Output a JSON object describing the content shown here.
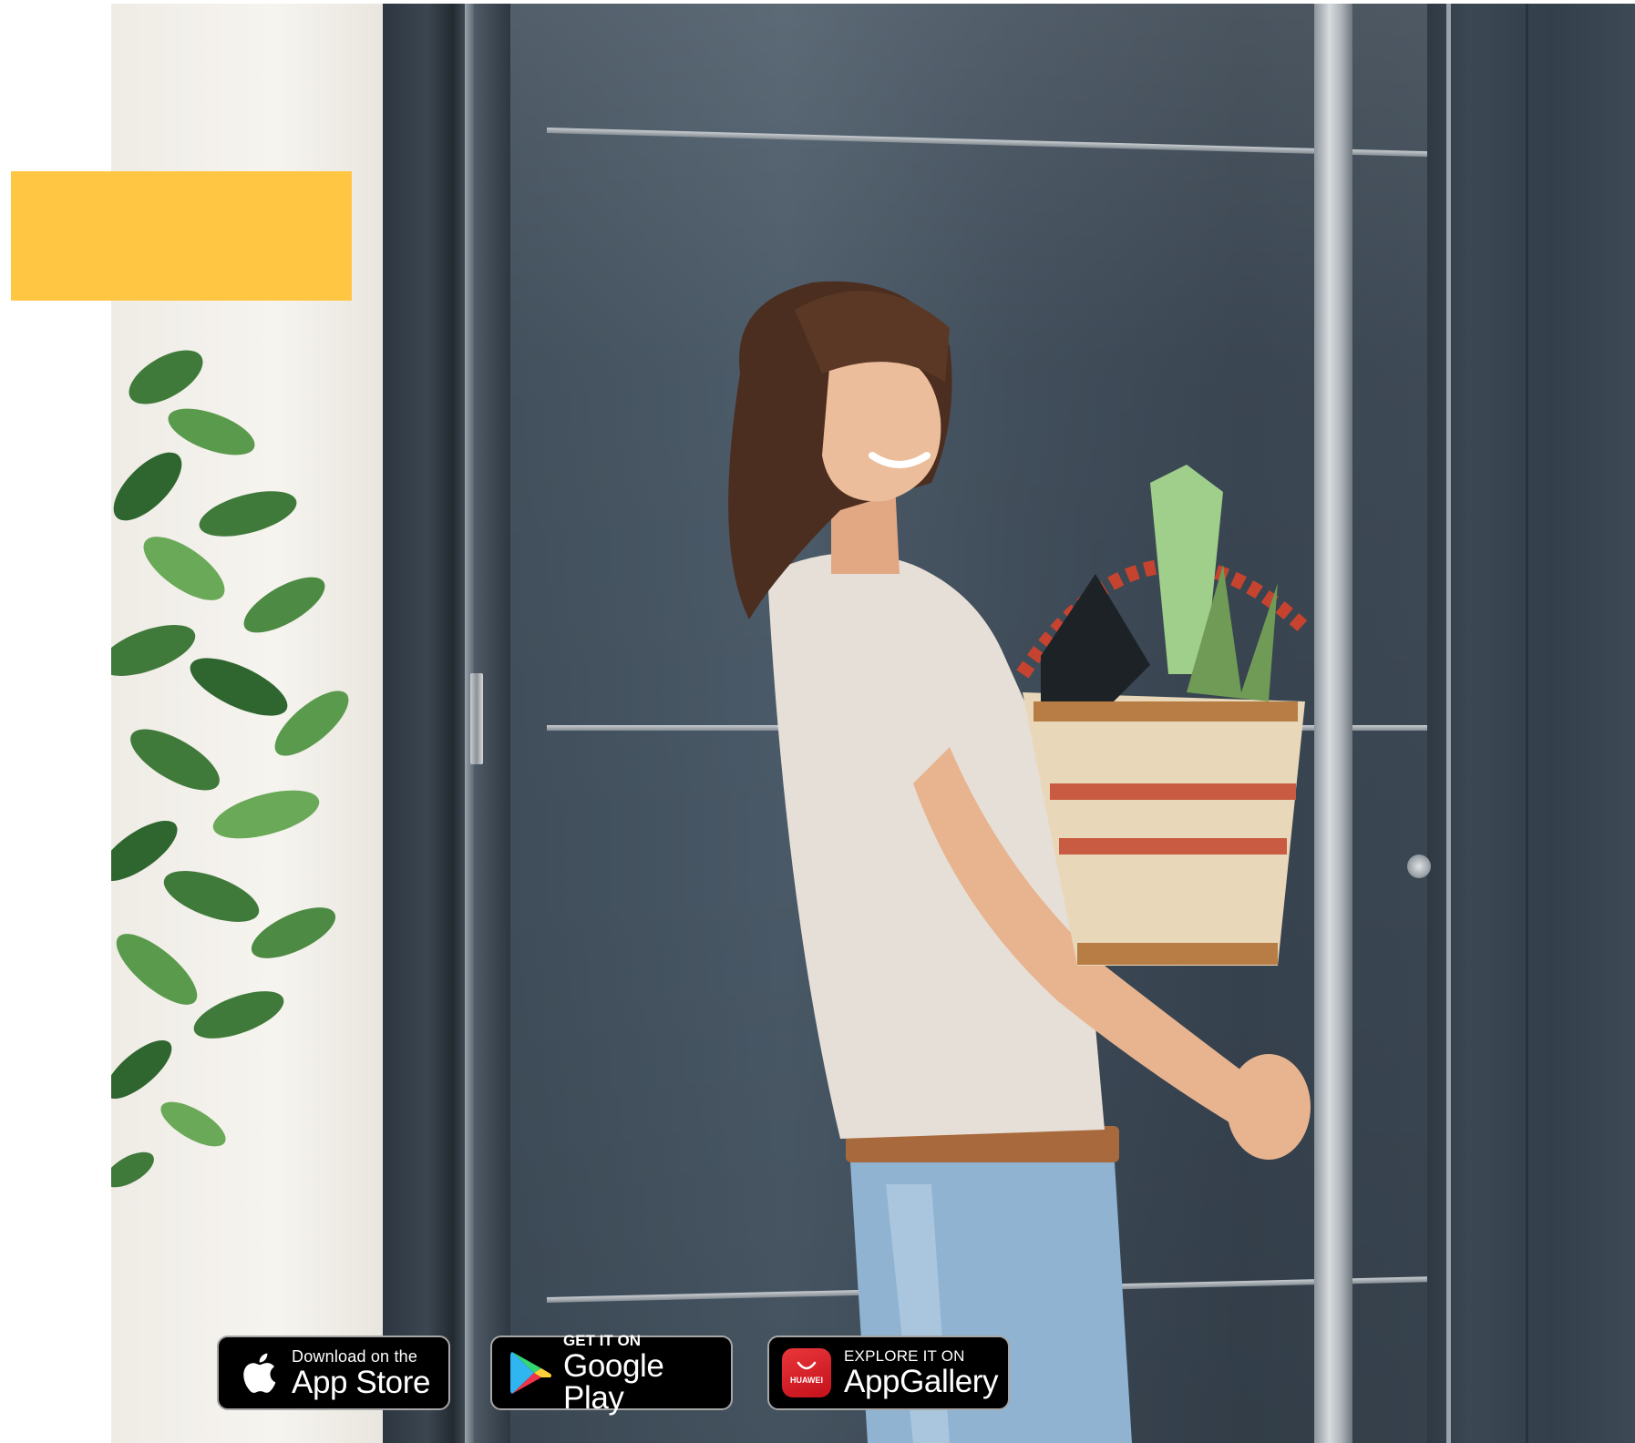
{
  "hero": {
    "accent_color": "#ffc643",
    "door_color": "#3f4d5a"
  },
  "badges": {
    "app_store": {
      "line1": "Download on the",
      "line2": "App Store",
      "icon": "apple-icon"
    },
    "google_play": {
      "line1": "GET IT ON",
      "line2": "Google Play",
      "icon": "google-play-icon"
    },
    "app_gallery": {
      "line1": "EXPLORE IT ON",
      "line2": "AppGallery",
      "icon_text": "HUAWEI",
      "icon": "huawei-appgallery-icon"
    }
  }
}
